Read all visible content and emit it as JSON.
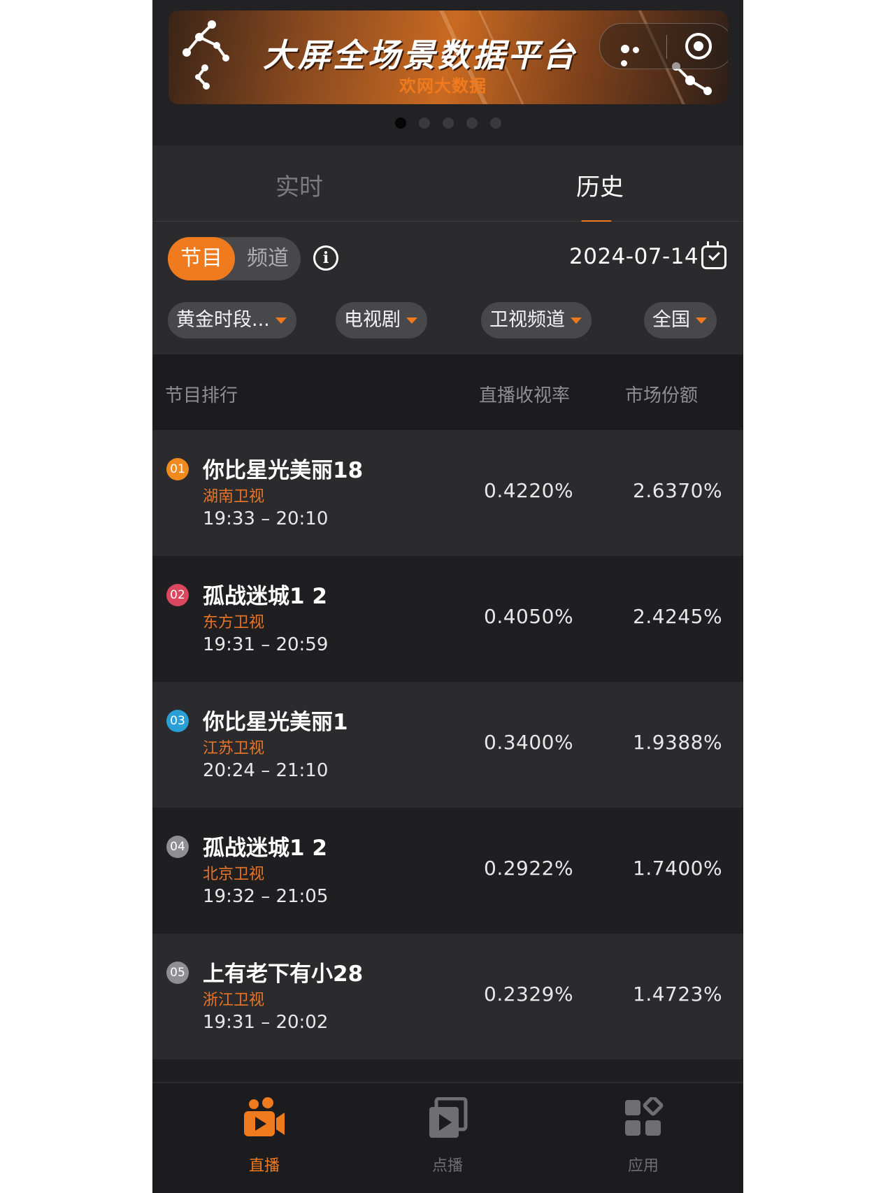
{
  "banner": {
    "title": "大屏全场景数据平台",
    "subtitle": "欢网大数据",
    "pager_count": 5,
    "pager_active": 0
  },
  "tabs": [
    {
      "label": "实时",
      "active": false
    },
    {
      "label": "历史",
      "active": true
    }
  ],
  "segment": {
    "options": [
      "节目",
      "频道"
    ],
    "selected": "节目"
  },
  "date": "2024-07-14",
  "filters": [
    "黄金时段...",
    "电视剧",
    "卫视频道",
    "全国"
  ],
  "table": {
    "headers": [
      "节目排行",
      "直播收视率",
      "市场份额"
    ],
    "rows": [
      {
        "rank": "01",
        "title": "你比星光美丽18",
        "channel": "湖南卫视",
        "time": "19:33 – 20:10",
        "rating": "0.4220%",
        "share": "2.6370%",
        "badge_color": "#f08a1e"
      },
      {
        "rank": "02",
        "title": "孤战迷城1 2",
        "channel": "东方卫视",
        "time": "19:31 – 20:59",
        "rating": "0.4050%",
        "share": "2.4245%",
        "badge_color": "#d9485f"
      },
      {
        "rank": "03",
        "title": "你比星光美丽1",
        "channel": "江苏卫视",
        "time": "20:24 – 21:10",
        "rating": "0.3400%",
        "share": "1.9388%",
        "badge_color": "#2a9fd6"
      },
      {
        "rank": "04",
        "title": "孤战迷城1 2",
        "channel": "北京卫视",
        "time": "19:32 – 21:05",
        "rating": "0.2922%",
        "share": "1.7400%",
        "badge_color": "#8e8e93"
      },
      {
        "rank": "05",
        "title": "上有老下有小28",
        "channel": "浙江卫视",
        "time": "19:31 – 20:02",
        "rating": "0.2329%",
        "share": "1.4723%",
        "badge_color": "#8e8e93"
      }
    ]
  },
  "nav": [
    {
      "label": "直播",
      "icon": "live-camera-icon",
      "active": true
    },
    {
      "label": "点播",
      "icon": "vod-play-icon",
      "active": false
    },
    {
      "label": "应用",
      "icon": "apps-grid-icon",
      "active": false
    }
  ],
  "colors": {
    "accent": "#f07a1e",
    "background": "#1c1c1e"
  }
}
